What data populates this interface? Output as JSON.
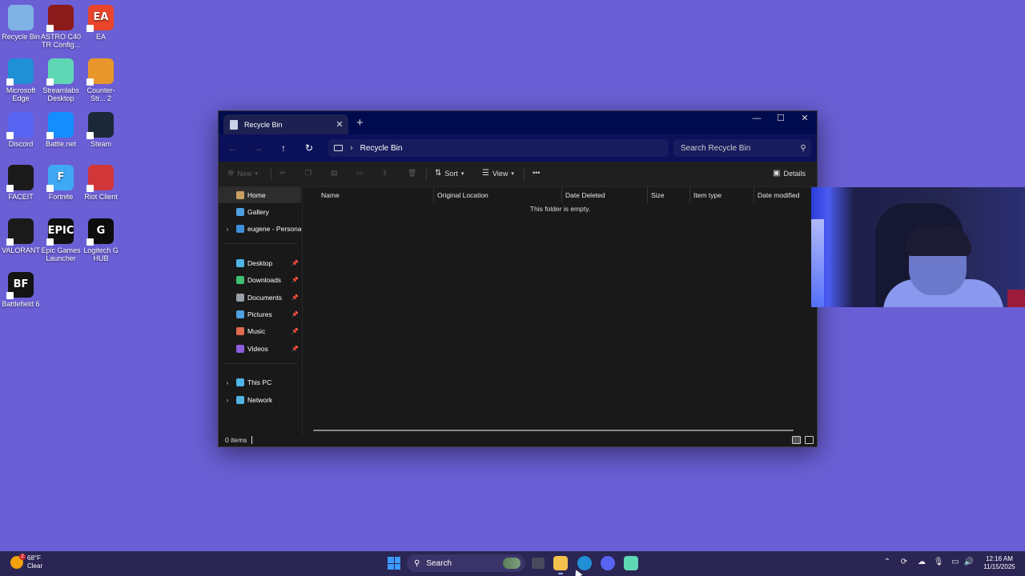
{
  "desktop": {
    "icons": [
      {
        "label": "Recycle Bin",
        "icon": "recycle-bin-icon",
        "color": "#7fb3e6"
      },
      {
        "label": "ASTRO C40 TR Config...",
        "icon": "astro-config-icon",
        "color": "#8b1a1a"
      },
      {
        "label": "EA",
        "icon": "ea-icon",
        "color": "#e8452b"
      },
      {
        "label": "Microsoft Edge",
        "icon": "edge-icon",
        "color": "#1f8fd6"
      },
      {
        "label": "Streamlabs Desktop",
        "icon": "streamlabs-icon",
        "color": "#5fd7b5"
      },
      {
        "label": "Counter-Str... 2",
        "icon": "counter-strike-icon",
        "color": "#e8962b"
      },
      {
        "label": "Discord",
        "icon": "discord-icon",
        "color": "#5865f2"
      },
      {
        "label": "Battle.net",
        "icon": "battlenet-icon",
        "color": "#148eff"
      },
      {
        "label": "Steam",
        "icon": "steam-icon",
        "color": "#1b2838"
      },
      {
        "label": "FACEIT",
        "icon": "faceit-icon",
        "color": "#1b1b1b"
      },
      {
        "label": "Fortnite",
        "icon": "fortnite-icon",
        "color": "#3fa9f5"
      },
      {
        "label": "Riot Client",
        "icon": "riot-client-icon",
        "color": "#d13639"
      },
      {
        "label": "VALORANT",
        "icon": "valorant-icon",
        "color": "#1a1a1a"
      },
      {
        "label": "Epic Games Launcher",
        "icon": "epic-games-icon",
        "color": "#111111"
      },
      {
        "label": "Logitech G HUB",
        "icon": "logitech-ghub-icon",
        "color": "#0d0d0d"
      },
      {
        "label": "Battlefield 6",
        "icon": "battlefield-icon",
        "color": "#141414"
      }
    ],
    "icon_glyphs": [
      "",
      "",
      "EA",
      "",
      "",
      "",
      "",
      "",
      "",
      "",
      "F",
      "",
      "",
      "EPIC",
      "G",
      "BF"
    ]
  },
  "explorer": {
    "tab_title": "Recycle Bin",
    "new_tab": "+",
    "window_controls": {
      "minimize": "—",
      "maximize": "☐",
      "close": "✕"
    },
    "nav_buttons": {
      "back": "←",
      "forward": "→",
      "up": "↑",
      "refresh": "↻"
    },
    "address": {
      "separator": "›",
      "location": "Recycle Bin"
    },
    "search_placeholder": "Search Recycle Bin",
    "toolbar": {
      "new": "New",
      "sort": "Sort",
      "view": "View",
      "more": "•••",
      "details": "Details"
    },
    "nav_pane": {
      "top": [
        {
          "label": "Home",
          "icon": "home-icon",
          "color": "#c9a063"
        },
        {
          "label": "Gallery",
          "icon": "gallery-icon",
          "color": "#4ea0e0"
        },
        {
          "label": "eugene - Personal",
          "icon": "onedrive-icon",
          "color": "#3f8fd8"
        }
      ],
      "pinned": [
        {
          "label": "Desktop",
          "icon": "desktop-folder-icon",
          "color": "#4fb4e6"
        },
        {
          "label": "Downloads",
          "icon": "downloads-icon",
          "color": "#3fbf6f"
        },
        {
          "label": "Documents",
          "icon": "documents-icon",
          "color": "#9aa0aa"
        },
        {
          "label": "Pictures",
          "icon": "pictures-icon",
          "color": "#4ea0e0"
        },
        {
          "label": "Music",
          "icon": "music-icon",
          "color": "#e06a4e"
        },
        {
          "label": "Videos",
          "icon": "videos-icon",
          "color": "#8e5de0"
        }
      ],
      "bottom": [
        {
          "label": "This PC",
          "icon": "this-pc-icon",
          "color": "#4fb4e6"
        },
        {
          "label": "Network",
          "icon": "network-icon",
          "color": "#4fb4e6"
        }
      ]
    },
    "columns": [
      "Name",
      "Original Location",
      "Date Deleted",
      "Size",
      "Item type",
      "Date modified"
    ],
    "empty_message": "This folder is empty.",
    "status": "0 items"
  },
  "taskbar": {
    "weather": {
      "temp": "68°F",
      "condition": "Clear",
      "badge": "2"
    },
    "search_label": "Search",
    "apps": [
      "task-view-icon",
      "file-explorer-icon",
      "edge-icon",
      "discord-icon",
      "streamlabs-icon"
    ],
    "clock": {
      "time": "12:16 AM",
      "date": "11/15/2025"
    }
  }
}
